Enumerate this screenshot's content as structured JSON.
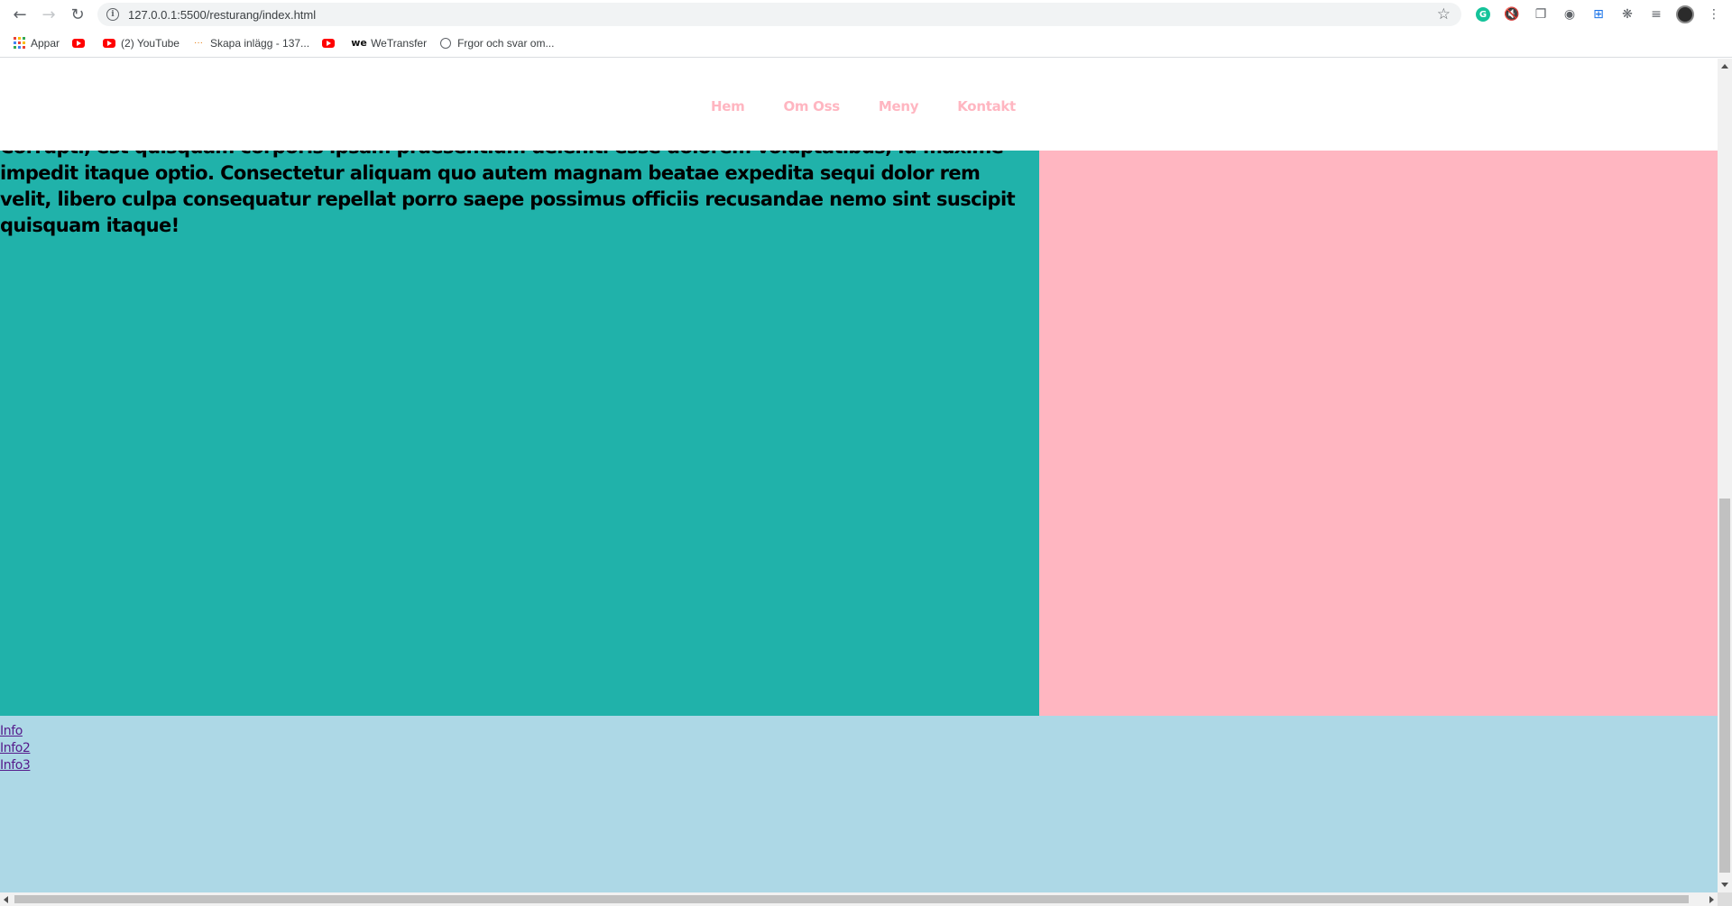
{
  "browser": {
    "url": "127.0.0.1:5500/resturang/index.html",
    "bookmarks": [
      {
        "label": "Appar",
        "icon": "apps-grid-icon"
      },
      {
        "label": "",
        "icon": "youtube-icon"
      },
      {
        "label": "(2) YouTube",
        "icon": "youtube-icon"
      },
      {
        "label": "Skapa inlägg - 137...",
        "icon": "dots-icon"
      },
      {
        "label": "",
        "icon": "youtube-icon"
      },
      {
        "label": "WeTransfer",
        "icon": "wetransfer-icon"
      },
      {
        "label": "Frgor och svar om...",
        "icon": "globe-icon"
      }
    ]
  },
  "site": {
    "nav": [
      "Hem",
      "Om Oss",
      "Meny",
      "Kontakt"
    ],
    "body_text": "Corrupti, est quisquam corporis ipsam praesentium deleniti esse dolorem voluptatibus, id maxime impedit itaque optio. Consectetur aliquam quo autem magnam beatae expedita sequi dolor rem velit, libero culpa consequatur repellat porro saepe possimus officiis recusandae nemo sint suscipit quisquam itaque!",
    "footer_links": [
      "Info",
      "Info2",
      "Info3"
    ]
  },
  "colors": {
    "nav_link": "#ffb6c1",
    "left_column": "#20b2aa",
    "right_column": "#ffb6c1",
    "footer": "#add8e6",
    "visited_link": "#551a8b"
  }
}
